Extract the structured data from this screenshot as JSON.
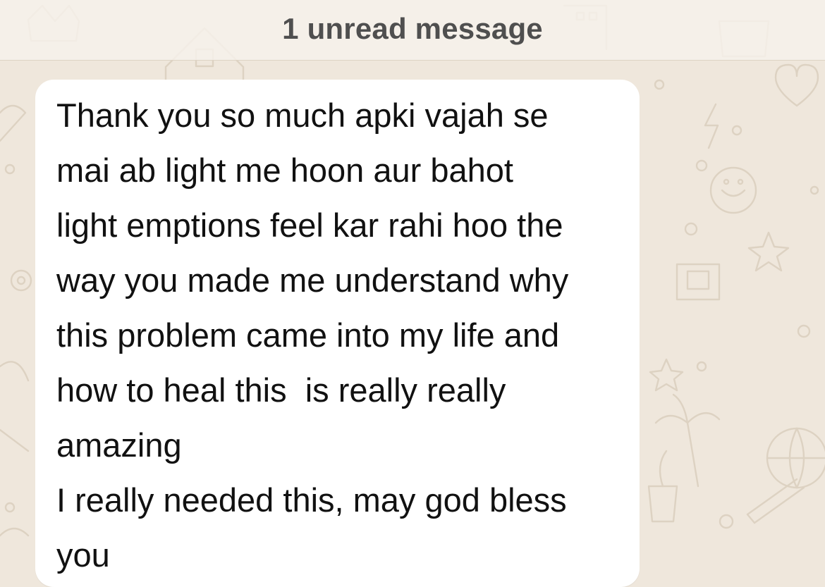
{
  "unread_banner": {
    "text": "1 unread message"
  },
  "message": {
    "text": "Thank you so much apki vajah se\nmai ab light me hoon aur bahot\nlight emptions feel kar rahi hoo the\nway you made me understand why\nthis problem came into my life and\nhow to heal this  is really really\namazing\nI really needed this, may god bless\nyou"
  },
  "colors": {
    "wallpaper": "#efe7dc",
    "doodle": "#ddd2c2",
    "bubble": "#ffffff",
    "message_text": "#111111",
    "banner_text": "#4f4f4f"
  }
}
